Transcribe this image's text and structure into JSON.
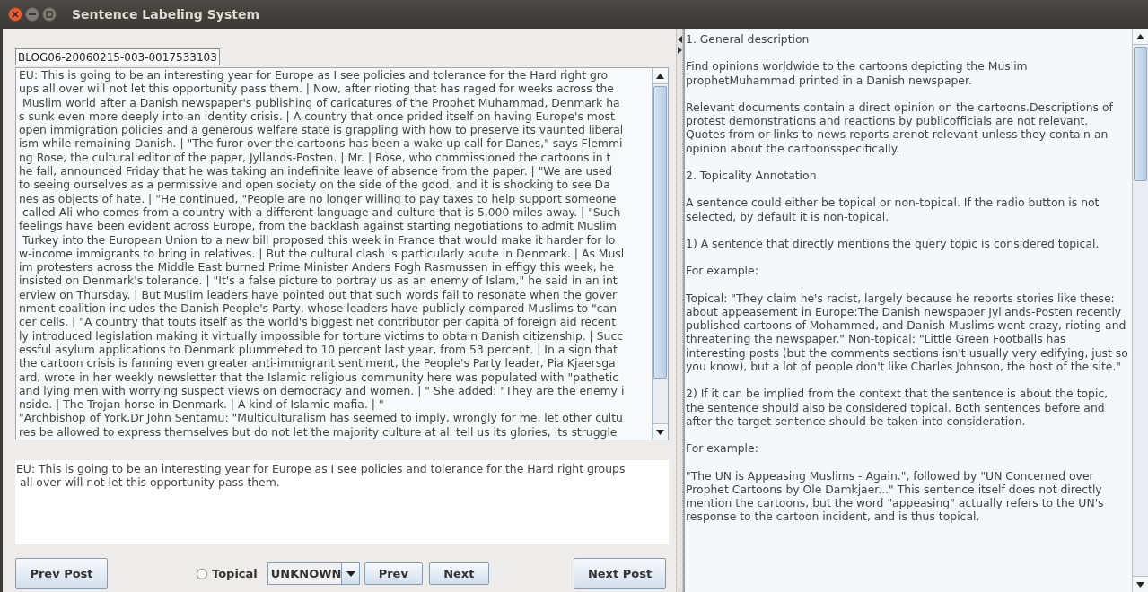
{
  "window": {
    "title": "Sentence Labeling System"
  },
  "post_id": "BLOG06-20060215-003-0017533103",
  "post_lines": [
    "EU: This is going to be an interesting year for Europe as I see policies and tolerance for the Hard right gro",
    "ups all over will not let this opportunity pass them. | Now, after rioting that has raged for weeks across the",
    " Muslim world after a Danish newspaper's publishing of caricatures of the Prophet Muhammad, Denmark ha",
    "s sunk even more deeply into an identity crisis. | A country that once prided itself on having Europe's most",
    "open immigration policies and a generous welfare state is grappling with how to preserve its vaunted liberal",
    "ism while remaining Danish. | \"The furor over the cartoons has been a wake-up call for Danes,\" says Flemmi",
    "ng Rose, the cultural editor of the paper, Jyllands-Posten. | Mr. | Rose, who commissioned the cartoons in t",
    "he fall, announced Friday that he was taking an indefinite leave of absence from the paper. | \"We are used",
    "to seeing ourselves as a permissive and open society on the side of the good, and it is shocking to see Da",
    "nes as objects of hate. | \"He continued, \"People are no longer willing to pay taxes to help support someone",
    " called Ali who comes from a country with a different language and culture that is 5,000 miles away. | \"Such",
    "feelings have been evident across Europe, from the backlash against starting negotiations to admit Muslim",
    " Turkey into the European Union to a new bill proposed this week in France that would make it harder for lo",
    "w-income immigrants to bring in relatives. | But the cultural clash is particularly acute in Denmark. | As Musl",
    "im protesters across the Middle East burned Prime Minister Anders Fogh Rasmussen in effigy this week, he",
    "insisted on Denmark's tolerance. | \"It's a false picture to portray us as an enemy of Islam,\" he said in an int",
    "erview on Thursday. | But Muslim leaders have pointed out that such words fail to resonate when the gover",
    "nment coalition includes the Danish People's Party, whose leaders have publicly compared Muslims to \"can",
    "cer cells. | \"A country that touts itself as the world's biggest net contributor per capita of foreign aid recent",
    "ly introduced legislation making it virtually impossible for torture victims to obtain Danish citizenship. | Succ",
    "essful asylum applications to Denmark plummeted to 10 percent last year, from 53 percent. | In a sign that",
    "the cartoon crisis is fanning even greater anti-immigrant sentiment, the People's Party leader, Pia Kjaersga",
    "ard, wrote in her weekly newsletter that the Islamic religious community here was populated with \"pathetic",
    "and lying men with worrying suspect views on democracy and women. | \" She added: \"They are the enemy i",
    "nside. | The Trojan horse in Denmark. | A kind of Islamic mafia. | \"",
    "\"Archbishop of York,Dr John Sentamu: \"Multiculturalism has seemed to imply, wrongly for me, let other cultu",
    "res be allowed to express themselves but do not let the majority culture at all tell us its glories, its struggle"
  ],
  "current_sentence": "EU: This is going to be an interesting year for Europe as I see policies and tolerance for the Hard right groups\n all over will not let this opportunity pass them.",
  "controls": {
    "prev_post": "Prev Post",
    "topical": {
      "label": "Topical",
      "selected": false
    },
    "label_select": "UNKNOWN",
    "prev": "Prev",
    "next": "Next",
    "next_post": "Next Post"
  },
  "guidelines": [
    {
      "text": "1. General description"
    },
    {
      "text": "Find opinions worldwide to the cartoons depicting the Muslim prophetMuhammad printed in a Danish newspaper."
    },
    {
      "text": "Relevant documents contain a direct opinion on the cartoons.Descriptions of protest demonstrations and reactions by publicofficials are not relevant. Quotes from or links to news reports arenot relevant unless they contain an opinion about the cartoonsspecifically."
    },
    {
      "text": "2. Topicality Annotation"
    },
    {
      "text": "A sentence could either be topical or non-topical. If the radio button is not selected, by default it is non-topical."
    },
    {
      "text": "1) A sentence that directly mentions the query topic is considered topical."
    },
    {
      "text": "For example:"
    },
    {
      "text": "Topical: \"They claim he's racist, largely because he reports stories like these: about appeasement in Europe:The Danish newspaper Jyllands-Posten recently published cartoons of Mohammed, and Danish Muslims went crazy, rioting and threatening the newspaper.\" Non-topical: \"Little Green Footballs has interesting posts (but the comments sections isn't usually very edifying, just so you know), but a lot of people don't like Charles Johnson, the host of the site.\""
    },
    {
      "text": "2) If it can be implied from the context that the sentence is about the topic, the sentence should also be considered topical. Both sentences before and after the target sentence should be taken into consideration."
    },
    {
      "text": "For example:"
    },
    {
      "text": "\"The UN is Appeasing Muslims - Again.\", followed by \"UN Concerned over Prophet Cartoons by Ole Damkjaer...\" This sentence itself does not directly mention the cartoons, but the word \"appeasing\" actually refers to the UN's response to the cartoon incident, and is thus topical."
    }
  ]
}
